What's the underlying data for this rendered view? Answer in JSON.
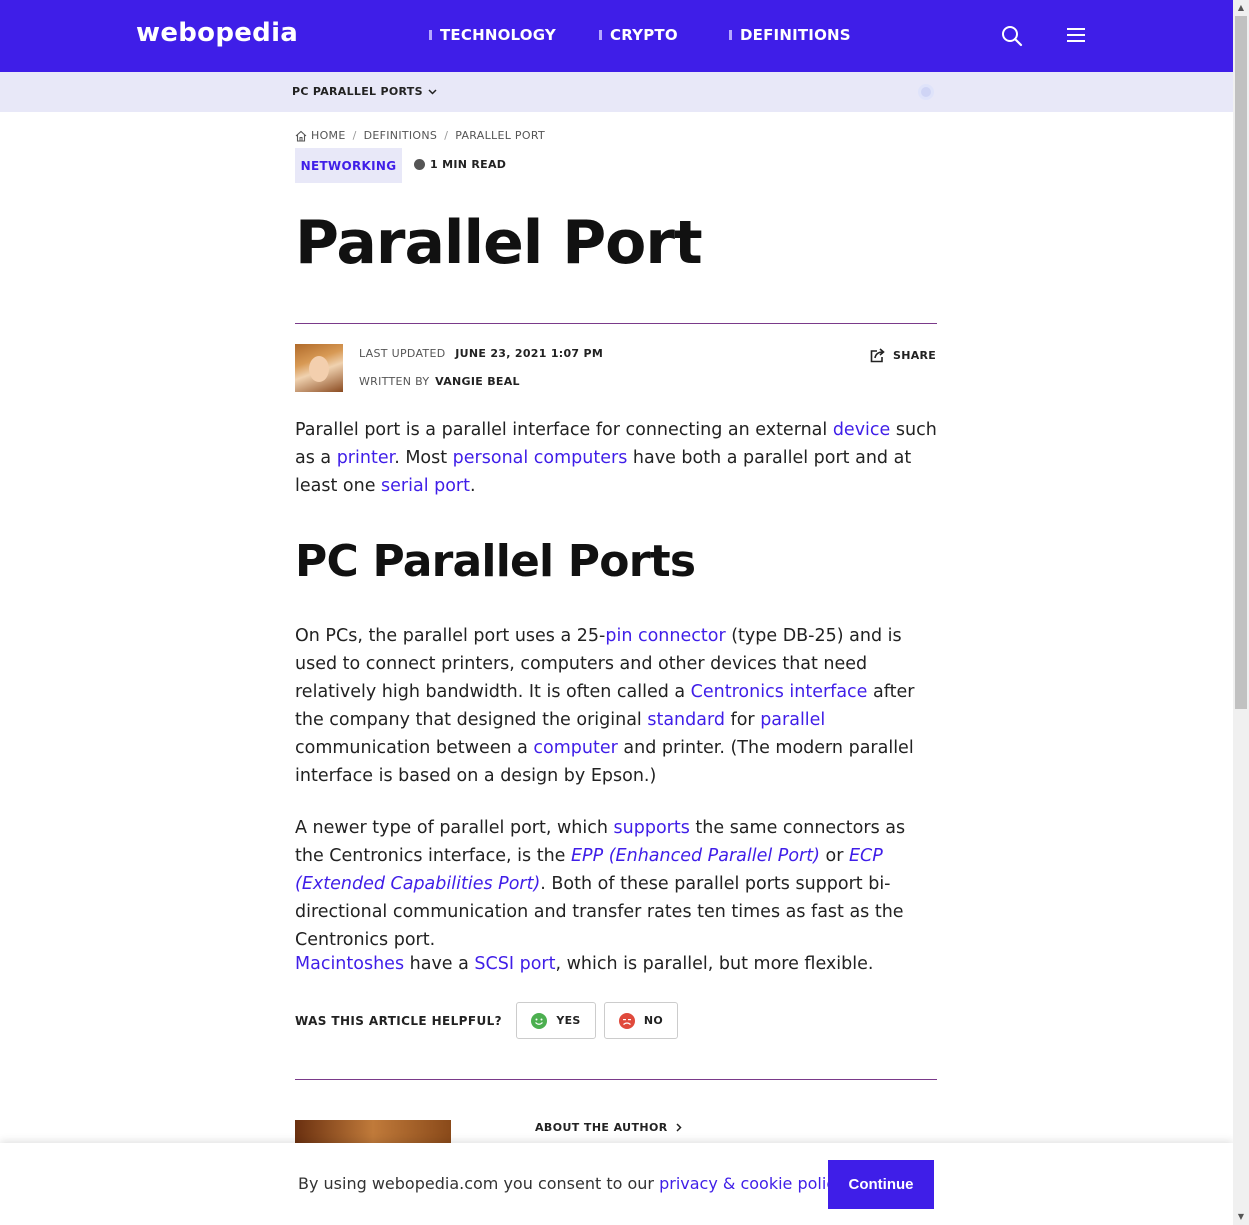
{
  "header": {
    "logo": "webopedia",
    "nav": [
      "TECHNOLOGY",
      "CRYPTO",
      "DEFINITIONS"
    ],
    "brand_color": "#3f1ee8",
    "icons": [
      "search-icon",
      "hamburger-menu-icon"
    ]
  },
  "subnav": {
    "toc_label": "PC PARALLEL PORTS"
  },
  "breadcrumb": [
    "HOME",
    "DEFINITIONS",
    "PARALLEL PORT"
  ],
  "category_tag": "NETWORKING",
  "read_time": "1 MIN READ",
  "article": {
    "title": "Parallel Port",
    "last_updated_label": "LAST UPDATED",
    "last_updated_value": "JUNE 23, 2021 1:07 PM",
    "written_by_label": "WRITTEN BY",
    "author": "VANGIE BEAL",
    "share_label": "SHARE",
    "p1": [
      "Parallel port is a parallel interface for connecting an external ",
      "device",
      " such as a ",
      "printer",
      ". Most ",
      "personal computers",
      " have both a parallel port and at least one ",
      "serial port",
      "."
    ],
    "section_heading": "PC Parallel Ports",
    "p2": [
      "On PCs, the parallel port uses a 25-",
      "pin connector",
      " (type DB-25) and is used to connect printers, computers and other devices that need relatively high bandwidth. It is often called a ",
      "Centronics interface",
      " after the company that designed the original ",
      "standard",
      " for ",
      "parallel",
      " communication between a ",
      "computer",
      " and printer. (The modern parallel interface is based on a design by Epson.)"
    ],
    "p3": [
      "A newer type of parallel port, which ",
      "supports",
      " the same connectors as the Centronics interface, is the ",
      "EPP (Enhanced Parallel Port)",
      " or ",
      "ECP (Extended Capabilities Port)",
      ". Both of these parallel ports support bi-directional communication and transfer rates ten times as fast as the Centronics port."
    ],
    "p4": [
      "Macintoshes",
      " have a ",
      "SCSI port",
      ", which is parallel, but more flexible."
    ]
  },
  "feedback": {
    "question": "WAS THIS ARTICLE HELPFUL?",
    "yes": "YES",
    "no": "NO"
  },
  "about_author": "ABOUT THE AUTHOR",
  "consent": {
    "text_before": "By using webopedia.com you consent to our ",
    "link": "privacy & cookie policy",
    "text_after": ".",
    "button": "Continue"
  }
}
